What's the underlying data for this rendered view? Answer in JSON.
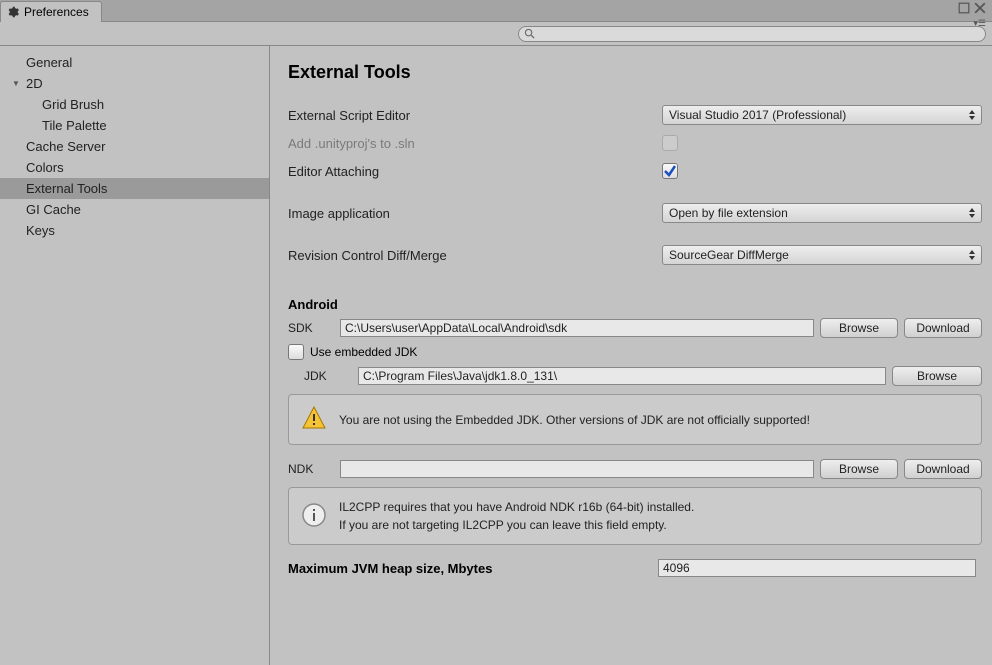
{
  "window": {
    "tab_title": "Preferences"
  },
  "search": {
    "placeholder": ""
  },
  "sidebar": {
    "items": [
      {
        "label": "General"
      },
      {
        "label": "2D"
      },
      {
        "label": "Grid Brush"
      },
      {
        "label": "Tile Palette"
      },
      {
        "label": "Cache Server"
      },
      {
        "label": "Colors"
      },
      {
        "label": "External Tools"
      },
      {
        "label": "GI Cache"
      },
      {
        "label": "Keys"
      }
    ]
  },
  "main": {
    "title": "External Tools",
    "external_script_editor": {
      "label": "External Script Editor",
      "value": "Visual Studio 2017 (Professional)"
    },
    "add_unityproj": {
      "label": "Add .unityproj's to .sln"
    },
    "editor_attaching": {
      "label": "Editor Attaching"
    },
    "image_application": {
      "label": "Image application",
      "value": "Open by file extension"
    },
    "revision_control": {
      "label": "Revision Control Diff/Merge",
      "value": "SourceGear DiffMerge"
    },
    "android": {
      "header": "Android",
      "sdk_label": "SDK",
      "sdk_value": "C:\\Users\\user\\AppData\\Local\\Android\\sdk",
      "use_embedded_label": "Use embedded JDK",
      "jdk_label": "JDK",
      "jdk_value": "C:\\Program Files\\Java\\jdk1.8.0_131\\",
      "jdk_warning": "You are not using the Embedded JDK. Other versions of JDK are not officially supported!",
      "ndk_label": "NDK",
      "ndk_value": "",
      "il2cpp_info_1": "IL2CPP requires that you have Android NDK r16b (64-bit) installed.",
      "il2cpp_info_2": "If you are not targeting IL2CPP you can leave this field empty.",
      "heap_label": "Maximum JVM heap size, Mbytes",
      "heap_value": "4096"
    },
    "buttons": {
      "browse": "Browse",
      "download": "Download"
    }
  }
}
